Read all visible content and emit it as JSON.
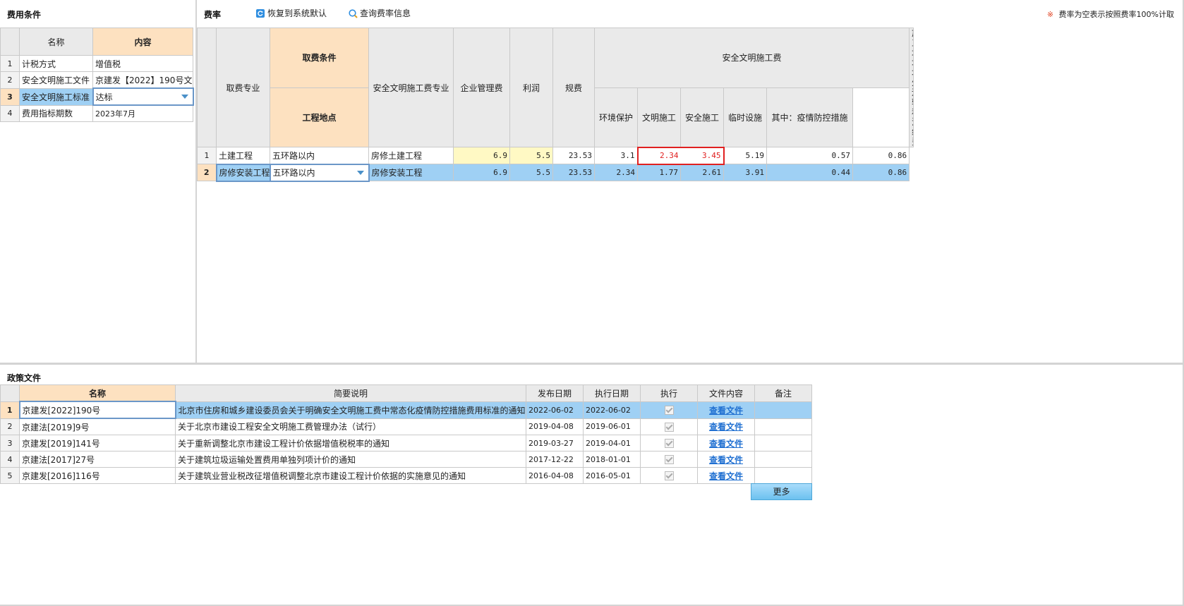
{
  "left_panel": {
    "title": "费用条件",
    "headers": {
      "name": "名称",
      "content": "内容"
    },
    "rows": [
      {
        "no": "1",
        "name": "计税方式",
        "value": "增值税"
      },
      {
        "no": "2",
        "name": "安全文明施工文件",
        "value": "京建发【2022】190号文"
      },
      {
        "no": "3",
        "name": "安全文明施工标准",
        "value": "达标"
      },
      {
        "no": "4",
        "name": "费用指标期数",
        "value": "2023年7月"
      }
    ]
  },
  "rate_panel": {
    "title": "费率",
    "restore_label": "恢复到系统默认",
    "query_label": "查询费率信息",
    "note_symbol": "※",
    "note_text": "费率为空表示按照费率100%计取",
    "headers": {
      "specialty": "取费专业",
      "condition": "取费条件",
      "location": "工程地点",
      "safety_specialty": "安全文明施工费专业",
      "mgmt": "企业管理费",
      "profit": "利润",
      "fees": "规费",
      "safety_group": "安全文明施工费",
      "env": "环境保护",
      "civil": "文明施工",
      "safe": "安全施工",
      "temp": "临时设施",
      "epidemic": "其中：疫情防控措施",
      "waste": "施工垃圾场外运输和消纳费"
    },
    "rows": [
      {
        "no": "1",
        "specialty": "土建工程",
        "location": "五环路以内",
        "safety_specialty": "房修土建工程",
        "mgmt": "6.9",
        "profit": "5.5",
        "fees": "23.53",
        "env": "3.1",
        "civil": "2.34",
        "safe": "3.45",
        "temp": "5.19",
        "epidemic": "0.57",
        "waste": "0.86"
      },
      {
        "no": "2",
        "specialty": "房修安装工程",
        "location": "五环路以内",
        "safety_specialty": "房修安装工程",
        "mgmt": "6.9",
        "profit": "5.5",
        "fees": "23.53",
        "env": "2.34",
        "civil": "1.77",
        "safe": "2.61",
        "temp": "3.91",
        "epidemic": "0.44",
        "waste": "0.86"
      }
    ]
  },
  "policy_panel": {
    "title": "政策文件",
    "headers": {
      "name": "名称",
      "desc": "简要说明",
      "publish": "发布日期",
      "exec": "执行日期",
      "run": "执行",
      "content": "文件内容",
      "remark": "备注"
    },
    "rows": [
      {
        "no": "1",
        "name": "京建发[2022]190号",
        "desc": "北京市住房和城乡建设委员会关于明确安全文明施工费中常态化疫情防控措施费用标准的通知",
        "publish": "2022-06-02",
        "exec": "2022-06-02",
        "link": "查看文件",
        "remark": ""
      },
      {
        "no": "2",
        "name": "京建法[2019]9号",
        "desc": "关于北京市建设工程安全文明施工费管理办法（试行）",
        "publish": "2019-04-08",
        "exec": "2019-06-01",
        "link": "查看文件",
        "remark": ""
      },
      {
        "no": "3",
        "name": "京建发[2019]141号",
        "desc": "关于重新调整北京市建设工程计价依据增值税税率的通知",
        "publish": "2019-03-27",
        "exec": "2019-04-01",
        "link": "查看文件",
        "remark": ""
      },
      {
        "no": "4",
        "name": "京建法[2017]27号",
        "desc": "关于建筑垃圾运输处置费用单独列项计价的通知",
        "publish": "2017-12-22",
        "exec": "2018-01-01",
        "link": "查看文件",
        "remark": ""
      },
      {
        "no": "5",
        "name": "京建发[2016]116号",
        "desc": "关于建筑业营业税改征增值税调整北京市建设工程计价依据的实施意见的通知",
        "publish": "2016-04-08",
        "exec": "2016-05-01",
        "link": "查看文件",
        "remark": ""
      }
    ],
    "more_label": "更多"
  },
  "colors": {
    "selected_row": "#9fd0f4",
    "header_highlight": "#fde1c0",
    "link": "#1f6fd1",
    "highlight_border": "#e02020",
    "yellow_cell": "#fff9c4"
  }
}
